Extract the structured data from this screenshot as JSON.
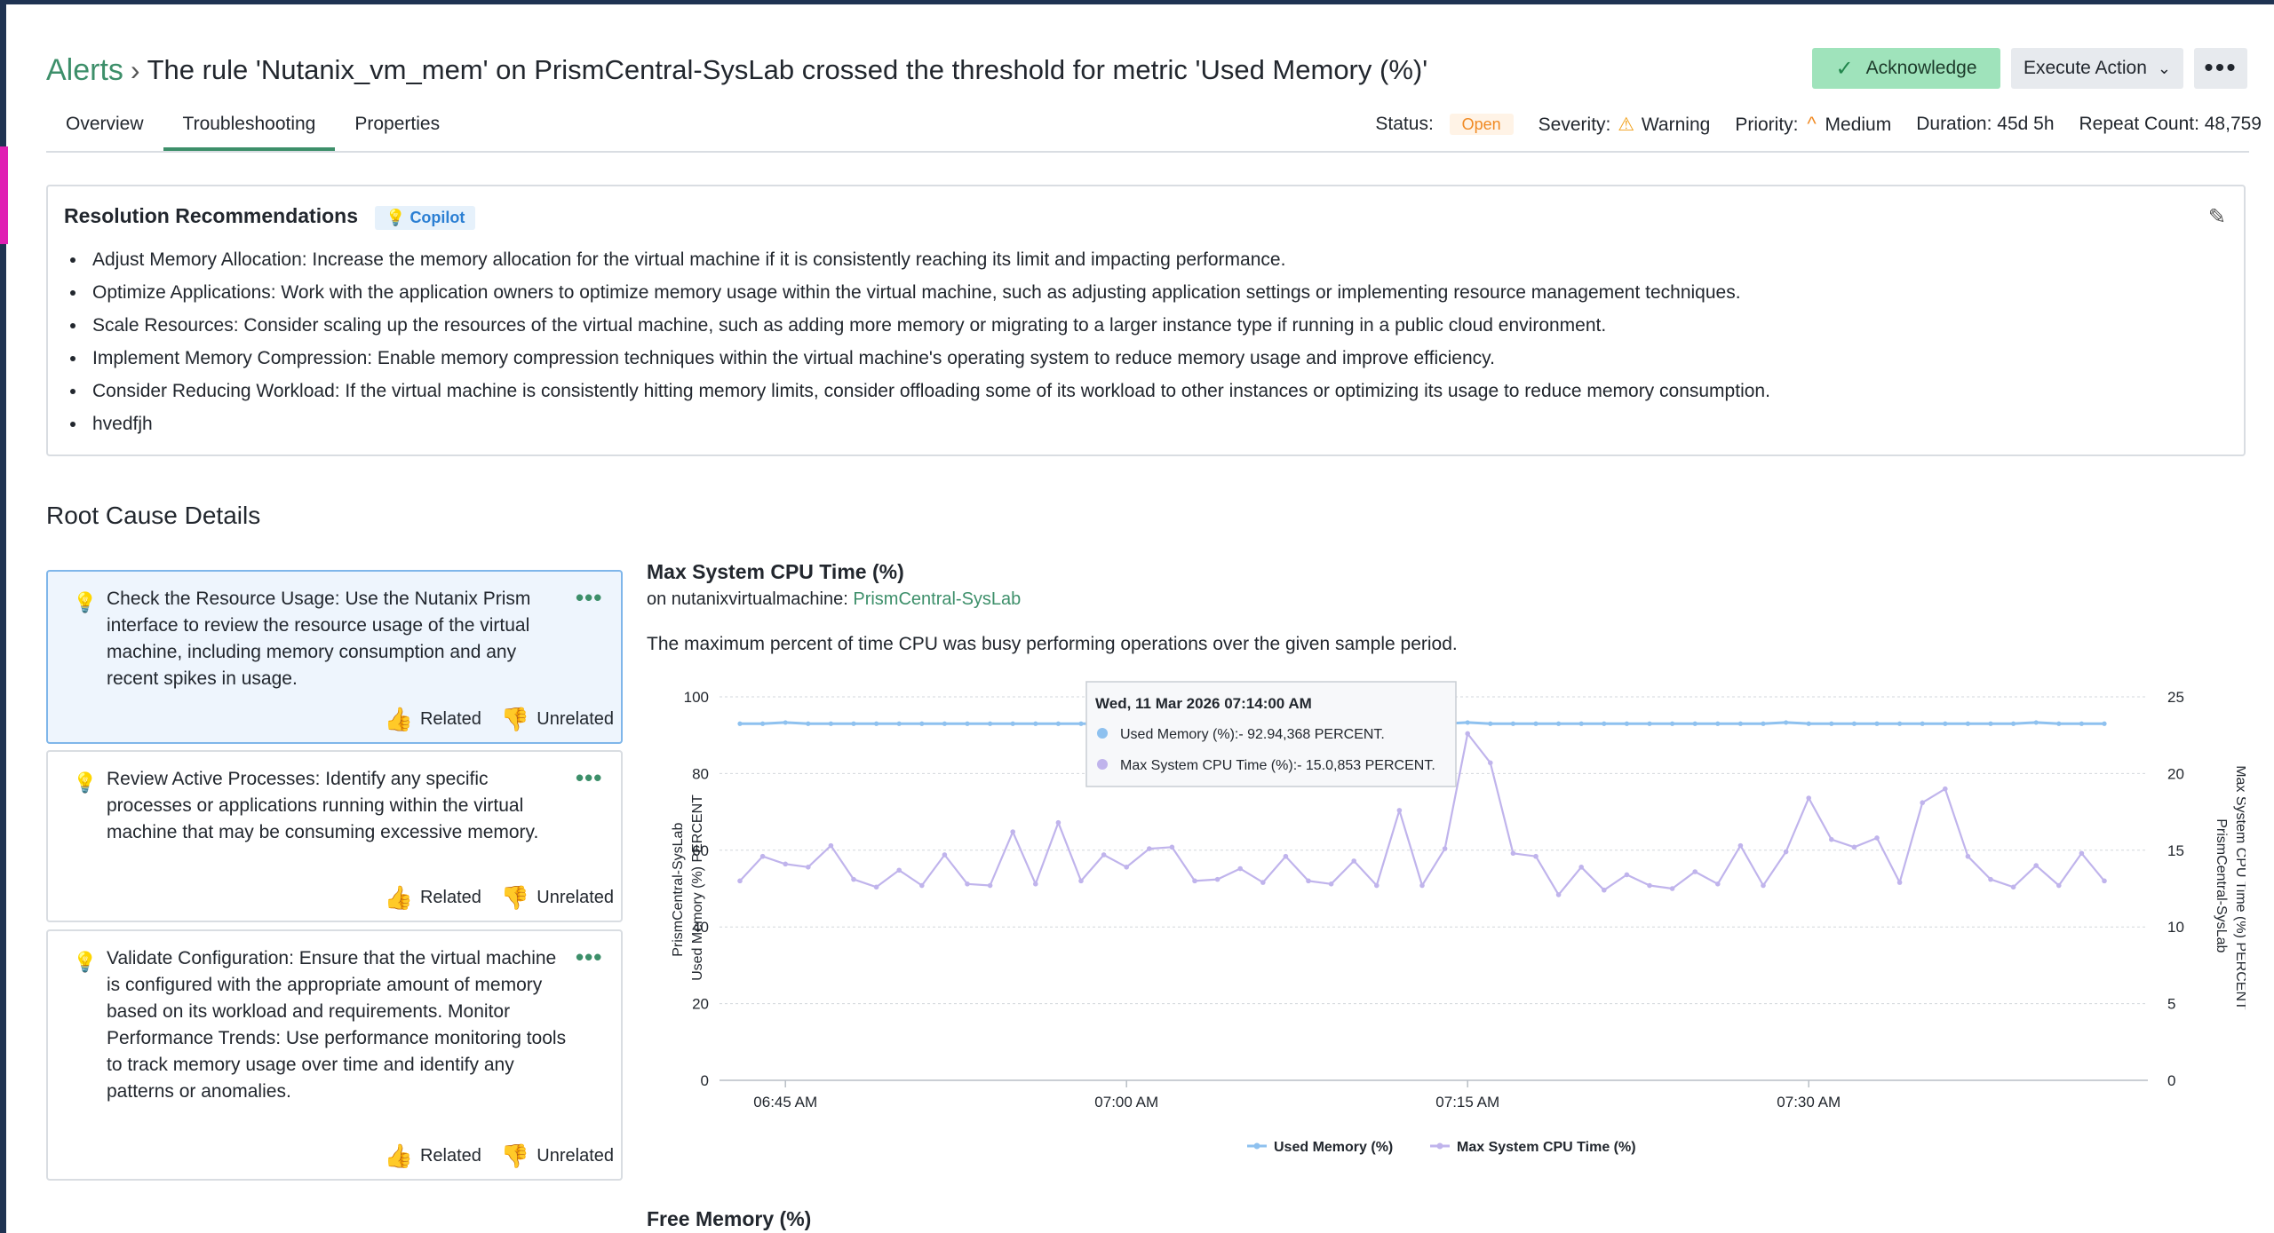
{
  "header": {
    "breadcrumb": "Alerts",
    "separator": "›",
    "title": "The rule 'Nutanix_vm_mem' on PrismCentral-SysLab crossed the threshold for metric 'Used Memory (%)'",
    "acknowledge_label": "Acknowledge",
    "execute_label": "Execute Action",
    "more_label": "•••"
  },
  "tabs": [
    "Overview",
    "Troubleshooting",
    "Properties"
  ],
  "active_tab": "Troubleshooting",
  "status_bar": {
    "status_label": "Status:",
    "status_value": "Open",
    "severity_label": "Severity:",
    "severity_value": "Warning",
    "priority_label": "Priority:",
    "priority_value": "Medium",
    "duration": "Duration: 45d 5h",
    "repeat_count": "Repeat Count: 48,759"
  },
  "recommendations": {
    "title": "Resolution Recommendations",
    "badge": "Copilot",
    "items": [
      "Adjust Memory Allocation: Increase the memory allocation for the virtual machine if it is consistently reaching its limit and impacting performance.",
      "Optimize Applications: Work with the application owners to optimize memory usage within the virtual machine, such as adjusting application settings or implementing resource management techniques.",
      "Scale Resources: Consider scaling up the resources of the virtual machine, such as adding more memory or migrating to a larger instance type if running in a public cloud environment.",
      "Implement Memory Compression: Enable memory compression techniques within the virtual machine's operating system to reduce memory usage and improve efficiency.",
      "Consider Reducing Workload: If the virtual machine is consistently hitting memory limits, consider offloading some of its workload to other instances or optimizing its usage to reduce memory consumption.",
      "hvedfjh"
    ]
  },
  "root_cause": {
    "title": "Root Cause Details",
    "related_label": "Related",
    "unrelated_label": "Unrelated",
    "cards": [
      "Check the Resource Usage: Use the Nutanix Prism interface to review the resource usage of the virtual machine, including memory consumption and any recent spikes in usage.",
      "Review Active Processes: Identify any specific processes or applications running within the virtual machine that may be consuming excessive memory.",
      "Validate Configuration: Ensure that the virtual machine is configured with the appropriate amount of memory based on its workload and requirements. Monitor Performance Trends: Use performance monitoring tools to track memory usage over time and identify any patterns or anomalies."
    ]
  },
  "chart_panel": {
    "title": "Max System CPU Time (%)",
    "entity_prefix": "on nutanixvirtualmachine:",
    "entity_link": "PrismCentral-SysLab",
    "description": "The maximum percent of time CPU was busy performing operations over the given sample period.",
    "next_title": "Free Memory (%)"
  },
  "chart_data": {
    "type": "line",
    "x_ticks": [
      "06:45 AM",
      "07:00 AM",
      "07:15 AM",
      "07:30 AM"
    ],
    "x_tick_positions": [
      2,
      17,
      32,
      47
    ],
    "left_axis": {
      "label_line1": "PrismCentral-SysLab",
      "label_line2": "Used Memory (%) PERCENT",
      "ticks": [
        "0",
        "20",
        "40",
        "60",
        "80",
        "100"
      ],
      "range": [
        0,
        100
      ]
    },
    "right_axis": {
      "label_line1": "PrismCentral-SysLab",
      "label_line2": "Max System CPU Time (%) PERCENT",
      "ticks": [
        "0",
        "5",
        "10",
        "15",
        "20",
        "25"
      ],
      "range": [
        0,
        25
      ]
    },
    "series": [
      {
        "name": "Used Memory (%)",
        "axis": "left",
        "color": "#8ec1ef",
        "values": [
          93,
          93,
          93.3,
          93,
          93,
          93,
          93,
          93,
          93,
          93,
          93,
          93,
          93,
          93,
          93,
          93,
          93,
          93,
          93,
          93,
          93,
          93,
          93,
          93,
          93,
          93,
          93,
          93,
          93,
          93,
          93,
          93,
          93.3,
          93,
          93,
          93,
          93,
          93,
          93,
          93,
          93,
          93,
          93,
          93,
          93,
          93,
          93.3,
          93,
          93,
          93,
          93,
          93,
          93,
          93,
          93,
          93,
          93,
          93.3,
          93,
          93,
          93
        ]
      },
      {
        "name": "Max System CPU Time (%)",
        "axis": "right",
        "color": "#c0b4ec",
        "values": [
          13,
          14.6,
          14.1,
          13.9,
          15.3,
          13.1,
          12.6,
          13.7,
          12.7,
          14.7,
          12.8,
          12.7,
          16.2,
          12.8,
          16.8,
          13,
          14.7,
          13.9,
          15.1,
          15.2,
          13,
          13.1,
          13.8,
          12.9,
          14.6,
          13,
          12.8,
          14.3,
          12.7,
          17.6,
          12.7,
          15.1,
          22.6,
          20.7,
          14.8,
          14.6,
          12.1,
          13.9,
          12.4,
          13.4,
          12.7,
          12.5,
          13.6,
          12.8,
          15.3,
          12.7,
          14.9,
          18.4,
          15.7,
          15.2,
          15.8,
          12.9,
          18.1,
          19,
          14.6,
          13.1,
          12.6,
          14,
          12.7,
          14.8,
          13
        ]
      }
    ],
    "tooltip": {
      "title": "Wed, 11 Mar 2026 07:14:00 AM",
      "line1": "Used Memory (%):- 92.94,368 PERCENT.",
      "line2": "Max System CPU Time (%):- 15.0,853 PERCENT."
    },
    "grid": true,
    "legend_position": "bottom"
  }
}
